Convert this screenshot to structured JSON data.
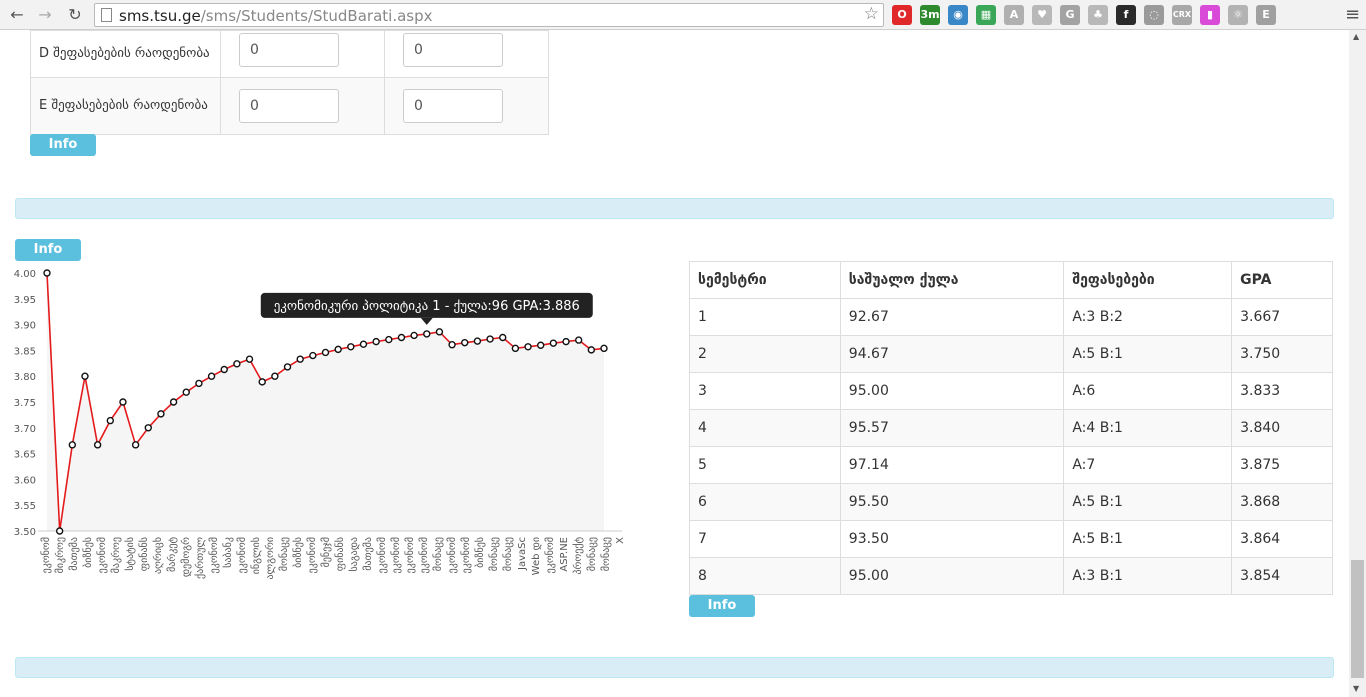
{
  "browser": {
    "url_host": "sms.tsu.ge",
    "url_path": "/sms/Students/StudBarati.aspx",
    "extensions": [
      {
        "name": "opera-icon",
        "color": "#e0282b",
        "glyph": "O"
      },
      {
        "name": "3m-badge-icon",
        "color": "#2d8b2d",
        "glyph": "3m"
      },
      {
        "name": "globe-icon",
        "color": "#3a87c8",
        "glyph": "◉"
      },
      {
        "name": "qr-icon",
        "color": "#3aa657",
        "glyph": "▦"
      },
      {
        "name": "angular-icon",
        "color": "#b0b0b0",
        "glyph": "A"
      },
      {
        "name": "heart-icon",
        "color": "#b8b8b8",
        "glyph": "♥"
      },
      {
        "name": "g-icon",
        "color": "#a3a3a3",
        "glyph": "G"
      },
      {
        "name": "tree-icon",
        "color": "#b8b8b8",
        "glyph": "♣"
      },
      {
        "name": "f-icon",
        "color": "#2a2a2a",
        "glyph": "f"
      },
      {
        "name": "circle-icon",
        "color": "#9a9a9a",
        "glyph": "◌"
      },
      {
        "name": "crx-icon",
        "color": "#a8a8a8",
        "glyph": "CRX"
      },
      {
        "name": "page-icon",
        "color": "#d94ad9",
        "glyph": "▮"
      },
      {
        "name": "react-icon",
        "color": "#b3b3b3",
        "glyph": "⚛"
      },
      {
        "name": "e-icon",
        "color": "#a0a0a0",
        "glyph": "E"
      }
    ]
  },
  "grades": {
    "rows": [
      {
        "label": "D შეფასებების რაოდენობა",
        "value1": "0",
        "value2": "0"
      },
      {
        "label": "E შეფასებების რაოდენობა",
        "value1": "0",
        "value2": "0"
      }
    ],
    "info_label": "Info"
  },
  "chart_section": {
    "info_label": "Info"
  },
  "chart_data": {
    "type": "line",
    "ylim": [
      3.5,
      4.0
    ],
    "yticks": [
      "4.00",
      "3.95",
      "3.90",
      "3.85",
      "3.80",
      "3.75",
      "3.70",
      "3.65",
      "3.60",
      "3.55",
      "3.50"
    ],
    "line_color": "#e41a1c",
    "tooltip": "ეკონომიკური პოლიტიკა 1 -  ქულა:96  GPA:3.886",
    "tooltip_index": 30,
    "x_labels": [
      "ეკონომ",
      "მიკროე",
      "მათემა",
      "ბიზნეს",
      "ეკონომ",
      "მაკროე",
      "სტატის",
      "ფინანს",
      "აღრიცხ",
      "მარკეტ",
      "დემოგრ",
      "ქართულ",
      "ეკონომ",
      "საბანკ",
      "ეკონომ",
      "ინგლის",
      "ალგორი",
      "მონაცე",
      "ბიზნეს",
      "ეკონომ",
      "მენეჯმ",
      "ფინანს",
      "საგადა",
      "მათემა",
      "ეკონომ",
      "ეკონომ",
      "ეკონომ",
      "ეკონომ",
      "მონაცე",
      "ეკონომ",
      "ეკონომ",
      "ბიზნეს",
      "მონაცე",
      "მონაცე",
      "JavaSc",
      "Web დი",
      "ეკონომ",
      "ASP.NE",
      "პროექტ",
      "მონაცე",
      "მონაცე",
      "X"
    ],
    "values": [
      4.0,
      3.5,
      3.667,
      3.8,
      3.667,
      3.714,
      3.75,
      3.667,
      3.7,
      3.727,
      3.75,
      3.769,
      3.786,
      3.8,
      3.813,
      3.824,
      3.833,
      3.789,
      3.8,
      3.818,
      3.833,
      3.84,
      3.846,
      3.852,
      3.857,
      3.862,
      3.867,
      3.871,
      3.875,
      3.879,
      3.882,
      3.886,
      3.861,
      3.865,
      3.868,
      3.872,
      3.875,
      3.854,
      3.857,
      3.86,
      3.864,
      3.867,
      3.87,
      3.851,
      3.854
    ]
  },
  "semesters": {
    "headers": [
      "სემესტრი",
      "საშუალო ქულა",
      "შეფასებები",
      "GPA"
    ],
    "rows": [
      [
        "1",
        "92.67",
        "A:3 B:2",
        "3.667"
      ],
      [
        "2",
        "94.67",
        "A:5 B:1",
        "3.750"
      ],
      [
        "3",
        "95.00",
        "A:6",
        "3.833"
      ],
      [
        "4",
        "95.57",
        "A:4 B:1",
        "3.840"
      ],
      [
        "5",
        "97.14",
        "A:7",
        "3.875"
      ],
      [
        "6",
        "95.50",
        "A:5 B:1",
        "3.868"
      ],
      [
        "7",
        "93.50",
        "A:5 B:1",
        "3.864"
      ],
      [
        "8",
        "95.00",
        "A:3 B:1",
        "3.854"
      ]
    ],
    "info_label": "Info"
  }
}
